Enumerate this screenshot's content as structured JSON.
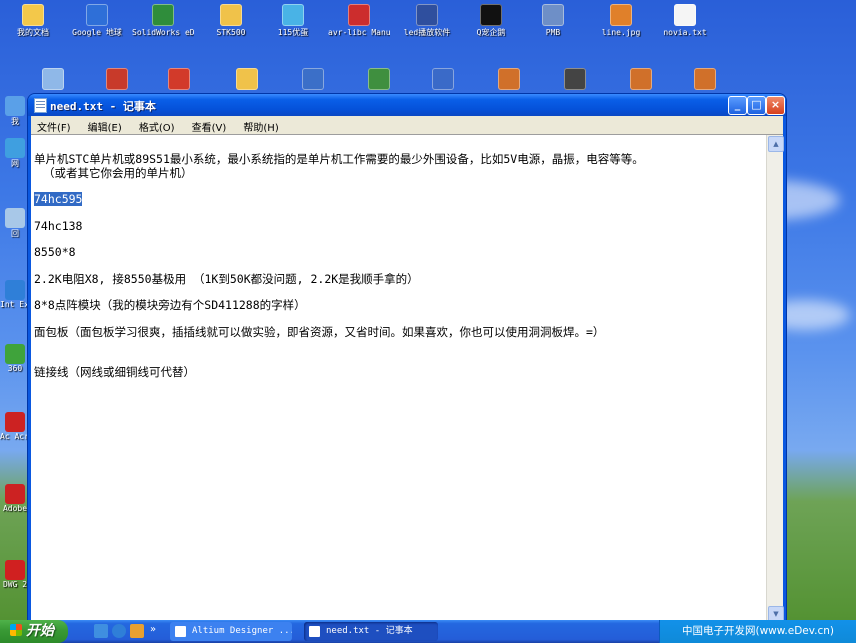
{
  "desktop": {
    "top_icons": [
      {
        "label": "我的文档",
        "color": "#f3c84a"
      },
      {
        "label": "Google 地球",
        "color": "#2e6fd8"
      },
      {
        "label": "SolidWorks eDrawin...",
        "color": "#2f8d3b"
      },
      {
        "label": "STK500",
        "color": "#f0c24a"
      },
      {
        "label": "115优蛋",
        "color": "#49b3e6"
      },
      {
        "label": "avr-libc Manua...",
        "color": "#cc2d2d"
      },
      {
        "label": "led播放软件",
        "color": "#2f4f9e"
      },
      {
        "label": "Q宠企鹅",
        "color": "#111111"
      },
      {
        "label": "PMB",
        "color": "#6e8fc7"
      },
      {
        "label": "line.jpg",
        "color": "#e0802a"
      },
      {
        "label": "novia.txt",
        "color": "#f5f5f5"
      }
    ],
    "left_icons": [
      {
        "label": "我",
        "color": "#5aa0e8"
      },
      {
        "label": "网",
        "color": "#3f9fe0"
      },
      {
        "label": "回",
        "color": "#a8c8e8"
      },
      {
        "label": "Int Exp",
        "color": "#2f7fd8"
      },
      {
        "label": "360",
        "color": "#3fa33b"
      },
      {
        "label": "Ac Acrob",
        "color": "#cc2222"
      },
      {
        "label": "Adobe",
        "color": "#cc2222"
      },
      {
        "label": "DWG 2",
        "color": "#d02020"
      }
    ]
  },
  "window": {
    "title": "need.txt - 记事本",
    "buttons": {
      "minimize": "_",
      "maximize": "□",
      "close": "×"
    },
    "menu": [
      "文件(F)",
      "编辑(E)",
      "格式(O)",
      "查看(V)",
      "帮助(H)"
    ],
    "lines": [
      {
        "text": "单片机STC单片机或89S51最小系统，最小系统指的是单片机工作需要的最少外围设备，比如5V电源，晶振，电容等等。",
        "selected": false
      },
      {
        "text": "（或者其它你会用的单片机）",
        "selected": false
      },
      {
        "text": "74hc595",
        "selected": true
      },
      {
        "text": "74hc138",
        "selected": false
      },
      {
        "text": "8550*8",
        "selected": false
      },
      {
        "text": "2.2K电阻X8, 接8550基极用 （1K到50K都没问题, 2.2K是我顺手拿的）",
        "selected": false
      },
      {
        "text": "8*8点阵模块（我的模块旁边有个SD411288的字样）",
        "selected": false
      },
      {
        "text": "面包板（面包板学习很爽，插插线就可以做实验，即省资源，又省时间。如果喜欢，你也可以使用洞洞板焊。=）",
        "selected": false
      },
      {
        "text": "链接线（网线或细铜线可代替）",
        "selected": false
      }
    ]
  },
  "taskbar": {
    "start_label": "开始",
    "tasks": [
      {
        "label": "Altium Designer ..."
      },
      {
        "label": "need.txt - 记事本"
      }
    ],
    "tray_text": "中国电子开发网(www.eDev.cn)"
  }
}
